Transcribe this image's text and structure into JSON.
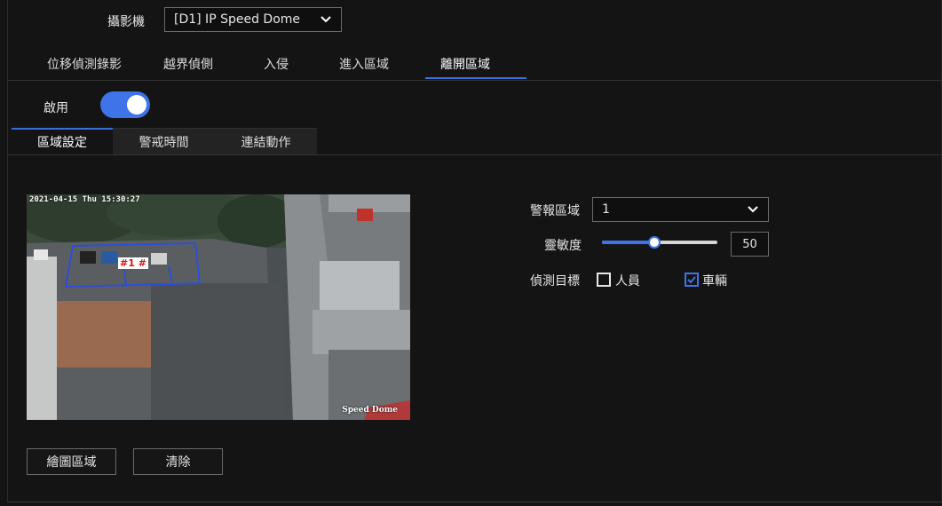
{
  "camera": {
    "label": "攝影機",
    "selected": "[D1] IP Speed Dome"
  },
  "detection_tabs": [
    {
      "label": "位移偵測錄影",
      "active": false
    },
    {
      "label": "越界偵側",
      "active": false
    },
    {
      "label": "入侵",
      "active": false
    },
    {
      "label": "進入區域",
      "active": false
    },
    {
      "label": "離開區域",
      "active": true
    }
  ],
  "enable": {
    "label": "啟用",
    "on": true
  },
  "sub_tabs": [
    {
      "label": "區域設定",
      "active": true
    },
    {
      "label": "警戒時間",
      "active": false
    },
    {
      "label": "連結動作",
      "active": false
    }
  ],
  "preview": {
    "timestamp": "2021-04-15 Thu 15:30:27",
    "camera_name": "Speed Dome",
    "zone_label": "#1 #"
  },
  "buttons": {
    "draw_area": "繪圖區域",
    "clear": "清除"
  },
  "settings": {
    "alarm_area_label": "警報區域",
    "alarm_area_value": "1",
    "sensitivity_label": "靈敏度",
    "sensitivity_value": "50",
    "sensitivity_max": 100,
    "detect_target_label": "偵測目標",
    "targets": [
      {
        "label": "人員",
        "checked": false
      },
      {
        "label": "車輛",
        "checked": true
      }
    ]
  },
  "colors": {
    "accent": "#3e74e8",
    "background": "#141414"
  }
}
